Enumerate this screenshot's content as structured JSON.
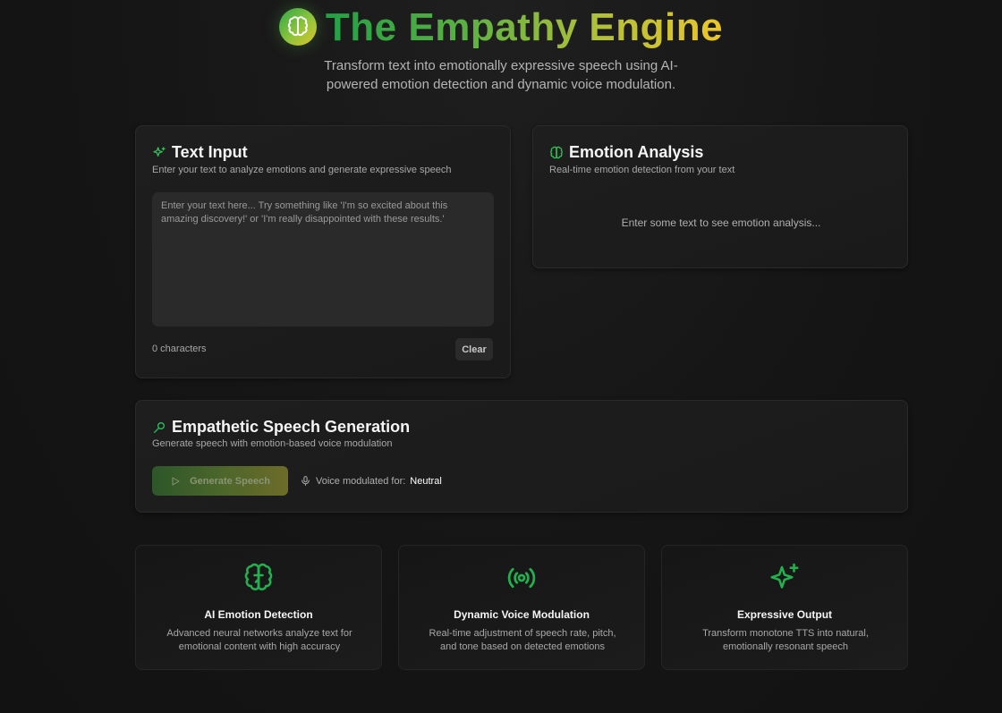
{
  "header": {
    "logo_icon": "brain-icon",
    "title": "The Empathy Engine",
    "subtitle": "Transform text into emotionally expressive speech using AI-powered emotion detection and dynamic voice modulation."
  },
  "text_input": {
    "icon": "sparkles-icon",
    "title": "Text Input",
    "description": "Enter your text to analyze emotions and generate expressive speech",
    "value": "",
    "placeholder": "Enter your text here... Try something like 'I'm so excited about this amazing discovery!' or 'I'm really disappointed with these results.'",
    "char_count": "0 characters",
    "clear_label": "Clear"
  },
  "emotion_analysis": {
    "icon": "brain-icon",
    "title": "Emotion Analysis",
    "description": "Real-time emotion detection from your text",
    "empty_state": "Enter some text to see emotion analysis..."
  },
  "speech": {
    "icon": "mic-icon",
    "title": "Empathetic Speech Generation",
    "description": "Generate speech with emotion-based voice modulation",
    "generate_label": "Generate Speech",
    "voice_label": "Voice modulated for:",
    "voice_value": "Neutral"
  },
  "features": [
    {
      "icon": "brain-icon",
      "title": "AI Emotion Detection",
      "description": "Advanced neural networks analyze text for emotional content with high accuracy"
    },
    {
      "icon": "radio-waves-icon",
      "title": "Dynamic Voice Modulation",
      "description": "Real-time adjustment of speech rate, pitch, and tone based on detected emotions"
    },
    {
      "icon": "sparkles-icon",
      "title": "Expressive Output",
      "description": "Transform monotone TTS into natural, emotionally resonant speech"
    }
  ],
  "colors": {
    "accent_green": "#22a045",
    "accent_yellow": "#ecc62a",
    "background": "#151515",
    "card": "#1e1e1e"
  }
}
